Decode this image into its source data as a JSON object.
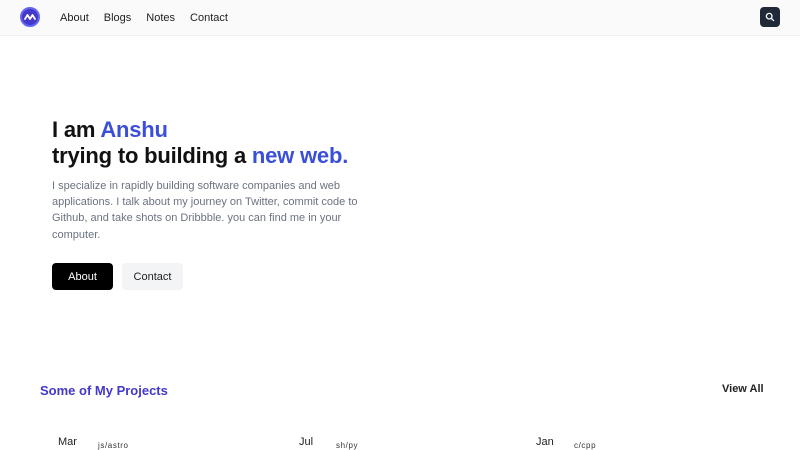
{
  "nav": {
    "links": [
      "About",
      "Blogs",
      "Notes",
      "Contact"
    ]
  },
  "hero": {
    "line1_prefix": "I am ",
    "line1_name": "Anshu",
    "line2_prefix": "trying to building a ",
    "line2_accent": "new web.",
    "description": "I specialize in rapidly building software companies and web applications. I talk about my journey on Twitter, commit code to Github, and take shots on Dribbble. you can find me in your computer.",
    "primary_button": "About",
    "secondary_button": "Contact"
  },
  "projects": {
    "heading": "Some of My Projects",
    "view_all": "View All",
    "items": [
      {
        "month": "Mar",
        "tech": "js/astro"
      },
      {
        "month": "Jul",
        "tech": "sh/py"
      },
      {
        "month": "Jan",
        "tech": "c/cpp"
      }
    ]
  },
  "colors": {
    "accent": "#3b4fd8",
    "section_heading": "#4338ca",
    "primary_button": "#000000"
  },
  "icons": {
    "logo": "logo-icon",
    "search": "search-icon"
  }
}
